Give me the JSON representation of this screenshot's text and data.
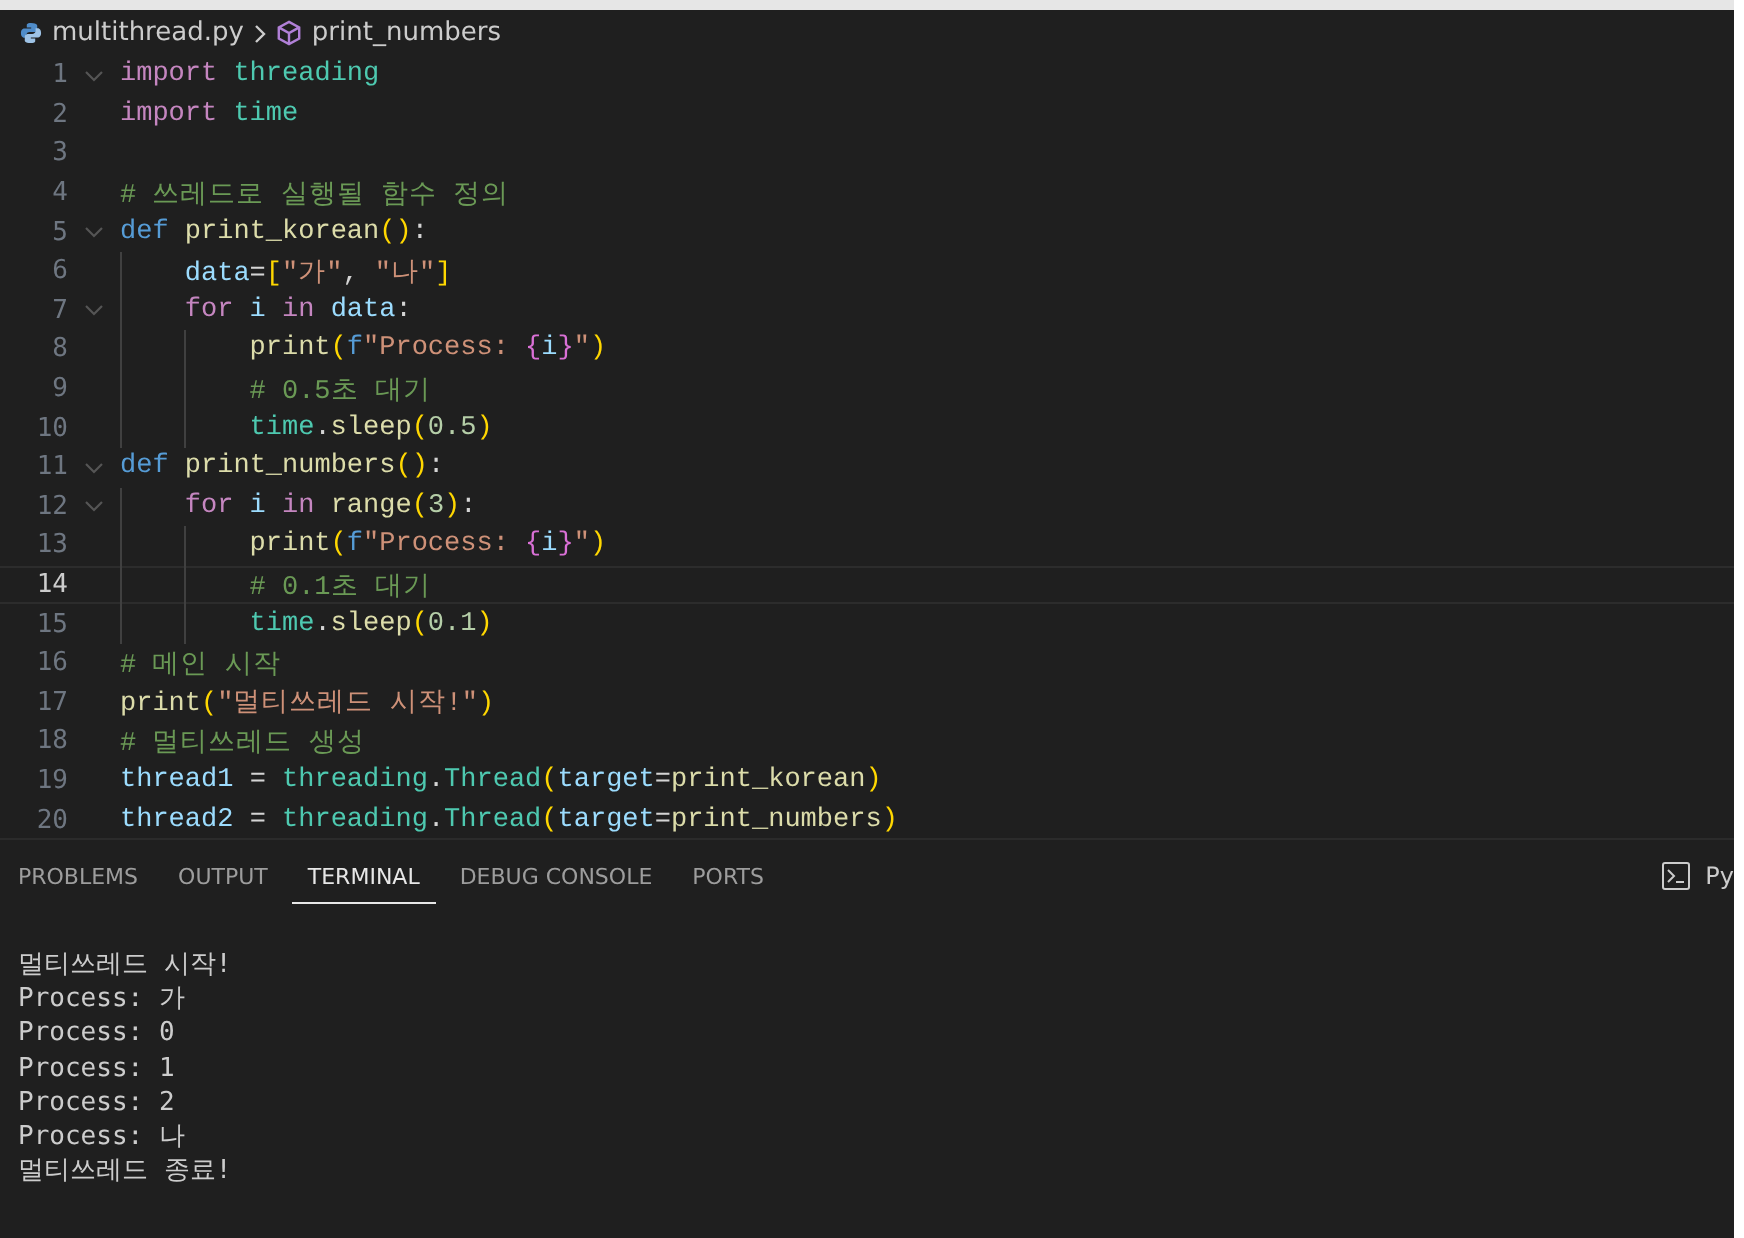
{
  "breadcrumb": {
    "file": "multithread.py",
    "symbol": "print_numbers"
  },
  "editor": {
    "lines": [
      {
        "number": "1",
        "foldable": true,
        "current": false,
        "tokens": [
          {
            "kind": "kw",
            "text": "import"
          },
          {
            "kind": "mod",
            "text": " threading"
          }
        ]
      },
      {
        "number": "2",
        "foldable": false,
        "current": false,
        "tokens": [
          {
            "kind": "kw",
            "text": "import"
          },
          {
            "kind": "mod",
            "text": " time"
          }
        ]
      },
      {
        "number": "3",
        "foldable": false,
        "current": false
      },
      {
        "number": "4",
        "foldable": false,
        "current": false,
        "tokens": [
          {
            "kind": "cmt",
            "text": "# 쓰레드로 실행될 함수 정의"
          }
        ]
      },
      {
        "number": "5",
        "foldable": true,
        "current": false,
        "tokens": [
          {
            "kind": "def",
            "text": "def"
          },
          {
            "kind": "fn",
            "text": " print_korean"
          },
          {
            "kind": "b1",
            "text": "()"
          },
          {
            "kind": "op",
            "text": ":"
          }
        ],
        "children": [
          {
            "number": "6",
            "foldable": false,
            "current": false,
            "tokens": [
              {
                "kind": "var",
                "text": "data"
              },
              {
                "kind": "op",
                "text": "="
              },
              {
                "kind": "b1",
                "text": "["
              },
              {
                "kind": "str",
                "text": "\"가\""
              },
              {
                "kind": "op",
                "text": ","
              },
              {
                "kind": "str",
                "text": " \"나\""
              },
              {
                "kind": "b1",
                "text": "]"
              }
            ]
          },
          {
            "number": "7",
            "foldable": true,
            "current": false,
            "tokens": [
              {
                "kind": "kw",
                "text": "for"
              },
              {
                "kind": "var",
                "text": " i"
              },
              {
                "kind": "kw",
                "text": " in"
              },
              {
                "kind": "var",
                "text": " data"
              },
              {
                "kind": "op",
                "text": ":"
              }
            ],
            "children": [
              {
                "number": "8",
                "foldable": false,
                "current": false,
                "tokens": [
                  {
                    "kind": "fn",
                    "text": "print"
                  },
                  {
                    "kind": "b1",
                    "text": "("
                  },
                  {
                    "kind": "def",
                    "text": "f"
                  },
                  {
                    "kind": "str",
                    "text": "\"Process: "
                  },
                  {
                    "kind": "b2",
                    "text": "{"
                  },
                  {
                    "kind": "var",
                    "text": "i"
                  },
                  {
                    "kind": "b2",
                    "text": "}"
                  },
                  {
                    "kind": "str",
                    "text": "\""
                  },
                  {
                    "kind": "b1",
                    "text": ")"
                  }
                ]
              },
              {
                "number": "9",
                "foldable": false,
                "current": false,
                "tokens": [
                  {
                    "kind": "cmt",
                    "text": "# 0.5초 대기"
                  }
                ]
              },
              {
                "number": "10",
                "foldable": false,
                "current": false,
                "tokens": [
                  {
                    "kind": "mod",
                    "text": "time"
                  },
                  {
                    "kind": "op",
                    "text": "."
                  },
                  {
                    "kind": "fn",
                    "text": "sleep"
                  },
                  {
                    "kind": "b1",
                    "text": "("
                  },
                  {
                    "kind": "num",
                    "text": "0.5"
                  },
                  {
                    "kind": "b1",
                    "text": ")"
                  }
                ]
              }
            ]
          }
        ]
      },
      {
        "number": "11",
        "foldable": true,
        "current": false,
        "tokens": [
          {
            "kind": "def",
            "text": "def"
          },
          {
            "kind": "fn",
            "text": " print_numbers"
          },
          {
            "kind": "b1",
            "text": "()"
          },
          {
            "kind": "op",
            "text": ":"
          }
        ],
        "children": [
          {
            "number": "12",
            "foldable": true,
            "current": false,
            "tokens": [
              {
                "kind": "kw",
                "text": "for"
              },
              {
                "kind": "var",
                "text": " i"
              },
              {
                "kind": "kw",
                "text": " in"
              },
              {
                "kind": "fn",
                "text": " range"
              },
              {
                "kind": "b1",
                "text": "("
              },
              {
                "kind": "num",
                "text": "3"
              },
              {
                "kind": "b1",
                "text": ")"
              },
              {
                "kind": "op",
                "text": ":"
              }
            ],
            "children": [
              {
                "number": "13",
                "foldable": false,
                "current": false,
                "tokens": [
                  {
                    "kind": "fn",
                    "text": "print"
                  },
                  {
                    "kind": "b1",
                    "text": "("
                  },
                  {
                    "kind": "def",
                    "text": "f"
                  },
                  {
                    "kind": "str",
                    "text": "\"Process: "
                  },
                  {
                    "kind": "b2",
                    "text": "{"
                  },
                  {
                    "kind": "var",
                    "text": "i"
                  },
                  {
                    "kind": "b2",
                    "text": "}"
                  },
                  {
                    "kind": "str",
                    "text": "\""
                  },
                  {
                    "kind": "b1",
                    "text": ")"
                  }
                ]
              },
              {
                "number": "14",
                "foldable": false,
                "current": true,
                "tokens": [
                  {
                    "kind": "cmt",
                    "text": "# 0.1초 대기"
                  }
                ]
              },
              {
                "number": "15",
                "foldable": false,
                "current": false,
                "tokens": [
                  {
                    "kind": "mod",
                    "text": "time"
                  },
                  {
                    "kind": "op",
                    "text": "."
                  },
                  {
                    "kind": "fn",
                    "text": "sleep"
                  },
                  {
                    "kind": "b1",
                    "text": "("
                  },
                  {
                    "kind": "num",
                    "text": "0.1"
                  },
                  {
                    "kind": "b1",
                    "text": ")"
                  }
                ]
              }
            ]
          }
        ]
      },
      {
        "number": "16",
        "foldable": false,
        "current": false,
        "tokens": [
          {
            "kind": "cmt",
            "text": "# 메인 시작"
          }
        ]
      },
      {
        "number": "17",
        "foldable": false,
        "current": false,
        "tokens": [
          {
            "kind": "fn",
            "text": "print"
          },
          {
            "kind": "b1",
            "text": "("
          },
          {
            "kind": "str",
            "text": "\"멀티쓰레드 시작!\""
          },
          {
            "kind": "b1",
            "text": ")"
          }
        ]
      },
      {
        "number": "18",
        "foldable": false,
        "current": false,
        "tokens": [
          {
            "kind": "cmt",
            "text": "# 멀티쓰레드 생성"
          }
        ]
      },
      {
        "number": "19",
        "foldable": false,
        "current": false,
        "tokens": [
          {
            "kind": "var",
            "text": "thread1"
          },
          {
            "kind": "op",
            "text": " ="
          },
          {
            "kind": "mod",
            "text": " threading"
          },
          {
            "kind": "op",
            "text": "."
          },
          {
            "kind": "mod",
            "text": "Thread"
          },
          {
            "kind": "b1",
            "text": "("
          },
          {
            "kind": "var",
            "text": "target"
          },
          {
            "kind": "op",
            "text": "="
          },
          {
            "kind": "fn",
            "text": "print_korean"
          },
          {
            "kind": "b1",
            "text": ")"
          }
        ]
      },
      {
        "number": "20",
        "foldable": false,
        "current": false,
        "tokens": [
          {
            "kind": "var",
            "text": "thread2"
          },
          {
            "kind": "op",
            "text": " ="
          },
          {
            "kind": "mod",
            "text": " threading"
          },
          {
            "kind": "op",
            "text": "."
          },
          {
            "kind": "mod",
            "text": "Thread"
          },
          {
            "kind": "b1",
            "text": "("
          },
          {
            "kind": "var",
            "text": "target"
          },
          {
            "kind": "op",
            "text": "="
          },
          {
            "kind": "fn",
            "text": "print_numbers"
          },
          {
            "kind": "b1",
            "text": ")"
          }
        ]
      }
    ]
  },
  "panel": {
    "tabs": [
      {
        "label": "PROBLEMS",
        "selected": false
      },
      {
        "label": "OUTPUT",
        "selected": false
      },
      {
        "label": "TERMINAL",
        "selected": true
      },
      {
        "label": "DEBUG CONSOLE",
        "selected": false
      },
      {
        "label": "PORTS",
        "selected": false
      }
    ],
    "terminal_label": "Py",
    "terminal_lines": [
      "멀티쓰레드 시작!",
      "Process: 가",
      "Process: 0",
      "Process: 1",
      "Process: 2",
      "Process: 나",
      "멀티쓰레드 종료!"
    ]
  }
}
